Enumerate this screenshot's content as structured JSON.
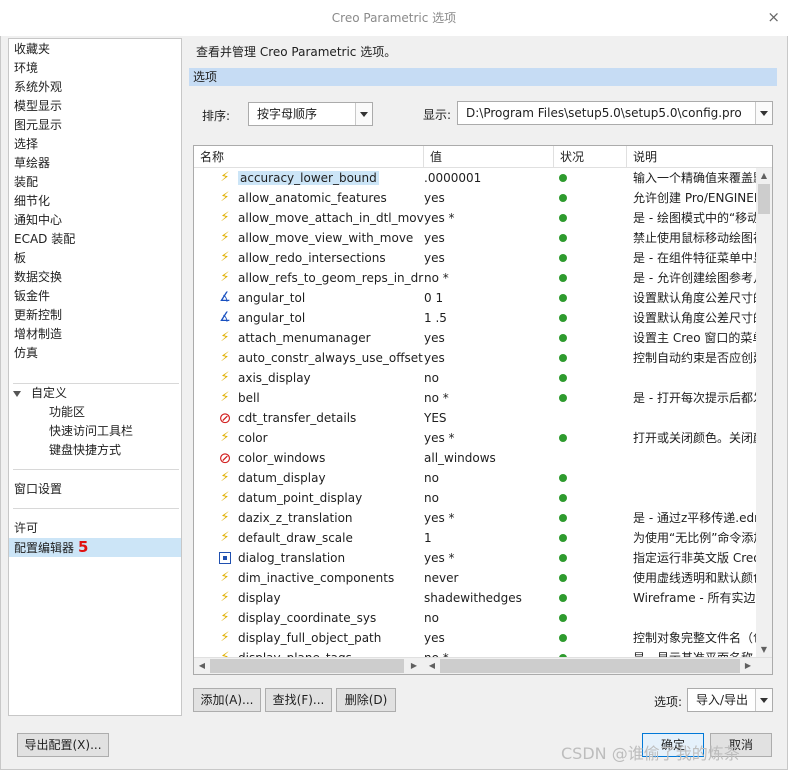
{
  "window": {
    "title": "Creo Parametric 选项",
    "close_glyph": "×"
  },
  "sidebar": {
    "items": [
      "收藏夹",
      "环境",
      "系统外观",
      "模型显示",
      "图元显示",
      "选择",
      "草绘器",
      "装配",
      "细节化",
      "通知中心",
      "ECAD 装配",
      "板",
      "数据交换",
      "钣金件",
      "更新控制",
      "增材制造",
      "仿真"
    ],
    "group_label": "自定义",
    "group_items": [
      "功能区",
      "快速访问工具栏",
      "键盘快捷方式"
    ],
    "window_settings": "窗口设置",
    "license": "许可",
    "config_editor": "配置编辑器",
    "badge": "5"
  },
  "main": {
    "description": "查看并管理 Creo Parametric 选项。",
    "section_title": "选项",
    "sort_label": "排序:",
    "sort_value": "按字母顺序",
    "show_label": "显示:",
    "show_value": "D:\\Program Files\\setup5.0\\setup5.0\\config.pro"
  },
  "table": {
    "headers": {
      "name": "名称",
      "value": "值",
      "status": "状况",
      "description": "说明"
    },
    "rows": [
      {
        "icon": "bolt-icon",
        "name": "accuracy_lower_bound",
        "value": ".0000001",
        "status": true,
        "desc": "输入一个精确值来覆盖默认"
      },
      {
        "icon": "bolt-icon",
        "name": "allow_anatomic_features",
        "value": "yes",
        "status": true,
        "desc": "允许创建 Pro/ENGINEER"
      },
      {
        "icon": "bolt-icon",
        "name": "allow_move_attach_in_dtl_move",
        "value": "yes *",
        "status": true,
        "desc": "是 - 绘图模式中的“移动”"
      },
      {
        "icon": "bolt-icon",
        "name": "allow_move_view_with_move",
        "value": "yes",
        "status": true,
        "desc": "禁止使用鼠标移动绘图视图"
      },
      {
        "icon": "bolt-icon",
        "name": "allow_redo_intersections",
        "value": "yes",
        "status": true,
        "desc": "是 - 在组件特征菜单中显示"
      },
      {
        "icon": "bolt-icon",
        "name": "allow_refs_to_geom_reps_in_drws",
        "value": "no *",
        "status": true,
        "desc": "是 - 允许创建绘图参考几何"
      },
      {
        "icon": "angle-icon",
        "name": "angular_tol",
        "value": "0 1",
        "status": true,
        "desc": "设置默认角度公差尺寸的"
      },
      {
        "icon": "angle-icon",
        "name": "angular_tol",
        "value": "1 .5",
        "status": true,
        "desc": "设置默认角度公差尺寸的"
      },
      {
        "icon": "bolt-icon",
        "name": "attach_menumanager",
        "value": "yes",
        "status": true,
        "desc": "设置主 Creo 窗口的菜单"
      },
      {
        "icon": "bolt-icon",
        "name": "auto_constr_always_use_offset",
        "value": "yes",
        "status": true,
        "desc": "控制自动约束是否应创建"
      },
      {
        "icon": "bolt-icon",
        "name": "axis_display",
        "value": "no",
        "status": true,
        "desc": ""
      },
      {
        "icon": "bolt-icon",
        "name": "bell",
        "value": "no *",
        "status": true,
        "desc": "是 - 打开每次提示后都发"
      },
      {
        "icon": "ban-icon",
        "name": "cdt_transfer_details",
        "value": "YES",
        "status": false,
        "desc": ""
      },
      {
        "icon": "bolt-icon",
        "name": "color",
        "value": "yes *",
        "status": true,
        "desc": "打开或关闭颜色。关闭颜色"
      },
      {
        "icon": "ban-icon",
        "name": "color_windows",
        "value": "all_windows",
        "status": false,
        "desc": ""
      },
      {
        "icon": "bolt-icon",
        "name": "datum_display",
        "value": "no",
        "status": true,
        "desc": ""
      },
      {
        "icon": "bolt-icon",
        "name": "datum_point_display",
        "value": "no",
        "status": true,
        "desc": ""
      },
      {
        "icon": "bolt-icon",
        "name": "dazix_z_translation",
        "value": "yes *",
        "status": true,
        "desc": "是 - 通过z平移传递.edn"
      },
      {
        "icon": "bolt-icon",
        "name": "default_draw_scale",
        "value": "1",
        "status": true,
        "desc": "为使用“无比例”命令添加"
      },
      {
        "icon": "box-icon",
        "name": "dialog_translation",
        "value": "yes *",
        "status": true,
        "desc": "指定运行非英文版 Creo"
      },
      {
        "icon": "bolt-icon",
        "name": "dim_inactive_components",
        "value": "never",
        "status": true,
        "desc": "使用虚线透明和默认颜色"
      },
      {
        "icon": "bolt-icon",
        "name": "display",
        "value": "shadewithedges",
        "status": true,
        "desc": "Wireframe - 所有实边"
      },
      {
        "icon": "bolt-icon",
        "name": "display_coordinate_sys",
        "value": "no",
        "status": true,
        "desc": ""
      },
      {
        "icon": "bolt-icon",
        "name": "display_full_object_path",
        "value": "yes",
        "status": true,
        "desc": "控制对象完整文件名（包"
      },
      {
        "icon": "bolt-icon",
        "name": "display_plane_tags",
        "value": "no *",
        "status": true,
        "desc": "是 - 显示基准平面名称"
      }
    ]
  },
  "buttons": {
    "add": "添加(A)...",
    "find": "查找(F)...",
    "delete": "删除(D)",
    "options_label": "选项:",
    "import_export": "导入/导出",
    "export_config": "导出配置(X)...",
    "ok": "确定",
    "cancel": "取消"
  },
  "watermark": "CSDN @谁偷了我的炼茶",
  "colors": {
    "selection": "#cce5f7",
    "section_bar": "#c6dcf4",
    "status_ok": "#2e9b2e",
    "badge": "#e01010"
  }
}
